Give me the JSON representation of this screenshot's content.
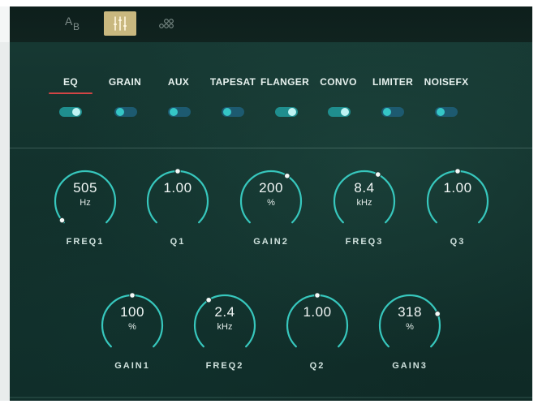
{
  "top_bar": {
    "ab_a": "A",
    "ab_b": "B",
    "buttons": [
      {
        "name": "ab-compare",
        "icon": "ab-icon"
      },
      {
        "name": "mixer",
        "icon": "sliders-icon",
        "active": true
      },
      {
        "name": "routing",
        "icon": "nodes-icon"
      }
    ]
  },
  "tabs": [
    {
      "label": "EQ",
      "active": true,
      "toggle_on": true
    },
    {
      "label": "GRAIN",
      "active": false,
      "toggle_on": false
    },
    {
      "label": "AUX",
      "active": false,
      "toggle_on": false
    },
    {
      "label": "TAPESAT",
      "active": false,
      "toggle_on": false
    },
    {
      "label": "FLANGER",
      "active": false,
      "toggle_on": true
    },
    {
      "label": "CONVO",
      "active": false,
      "toggle_on": true
    },
    {
      "label": "LIMITER",
      "active": false,
      "toggle_on": false
    },
    {
      "label": "NOISEFX",
      "active": false,
      "toggle_on": false
    }
  ],
  "knobs_row1": [
    {
      "label": "FREQ1",
      "value": "505",
      "unit": "Hz",
      "position": 0.02
    },
    {
      "label": "Q1",
      "value": "1.00",
      "unit": "",
      "position": 0.5
    },
    {
      "label": "GAIN2",
      "value": "200",
      "unit": "%",
      "position": 0.62
    },
    {
      "label": "FREQ3",
      "value": "8.4",
      "unit": "kHz",
      "position": 0.6
    },
    {
      "label": "Q3",
      "value": "1.00",
      "unit": "",
      "position": 0.5
    }
  ],
  "knobs_row2": [
    {
      "label": "GAIN1",
      "value": "100",
      "unit": "%",
      "position": 0.5
    },
    {
      "label": "FREQ2",
      "value": "2.4",
      "unit": "kHz",
      "position": 0.38
    },
    {
      "label": "Q2",
      "value": "1.00",
      "unit": "",
      "position": 0.5
    },
    {
      "label": "GAIN3",
      "value": "318",
      "unit": "%",
      "position": 0.75
    }
  ],
  "colors": {
    "accent_active_tab": "#d24545",
    "knob_arc": "#37c7bd",
    "panel_bg": "#12302b",
    "topbar_active": "#c9b87f"
  }
}
